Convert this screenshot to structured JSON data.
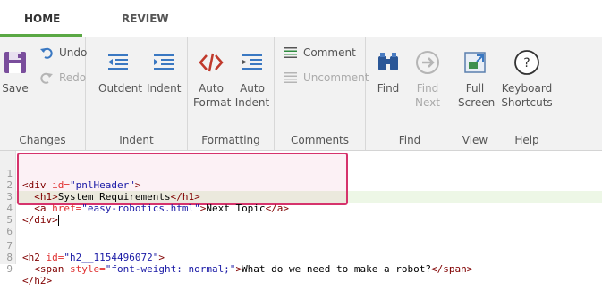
{
  "tabs": {
    "home": "HOME",
    "review": "REVIEW"
  },
  "ribbon": {
    "save": "Save",
    "undo": "Undo",
    "redo": "Redo",
    "outdent": "Outdent",
    "indent": "Indent",
    "auto_format_1": "Auto",
    "auto_format_2": "Format",
    "auto_indent_1": "Auto",
    "auto_indent_2": "Indent",
    "comment": "Comment",
    "uncomment": "Uncomment",
    "find": "Find",
    "find_next_1": "Find",
    "find_next_2": "Next",
    "full_screen_1": "Full",
    "full_screen_2": "Screen",
    "keyboard_1": "Keyboard",
    "keyboard_2": "Shortcuts",
    "groups": {
      "changes": "Changes",
      "indent": "Indent",
      "formatting": "Formatting",
      "comments": "Comments",
      "find": "Find",
      "view": "View",
      "help": "Help"
    }
  },
  "editor": {
    "line_numbers": [
      "1",
      "2",
      "3",
      "4",
      "5",
      "6",
      "7",
      "8",
      "9"
    ],
    "line1": {
      "open": "<div ",
      "attr": "id=",
      "val": "\"pnlHeader\"",
      "close": ">"
    },
    "line2": {
      "open": "  <h1>",
      "text": "System Requirements",
      "close": "</h1>"
    },
    "line3": {
      "open": "  <a ",
      "attr": "href=",
      "val": "\"easy-robotics.html\"",
      "mid": ">",
      "text": "Next Topic",
      "close": "</a>"
    },
    "line4": {
      "open": "</div>"
    },
    "line7": {
      "open": "<h2 ",
      "attr": "id=",
      "val": "\"h2__1154496072\"",
      "close": ">"
    },
    "line8": {
      "open": "  <span ",
      "attr": "style=",
      "val": "\"font-weight: normal;\"",
      "mid": ">",
      "text": "What do we need to make a robot?",
      "close": "</span>"
    },
    "line9": {
      "open": "</h2>"
    }
  },
  "colors": {
    "accent": "#5aa844",
    "selection_border": "#d6336c"
  },
  "icons": [
    "save-icon",
    "undo-icon",
    "redo-icon",
    "outdent-icon",
    "indent-icon",
    "auto-format-icon",
    "auto-indent-icon",
    "comment-icon",
    "uncomment-icon",
    "find-icon",
    "find-next-icon",
    "full-screen-icon",
    "keyboard-shortcuts-icon"
  ]
}
